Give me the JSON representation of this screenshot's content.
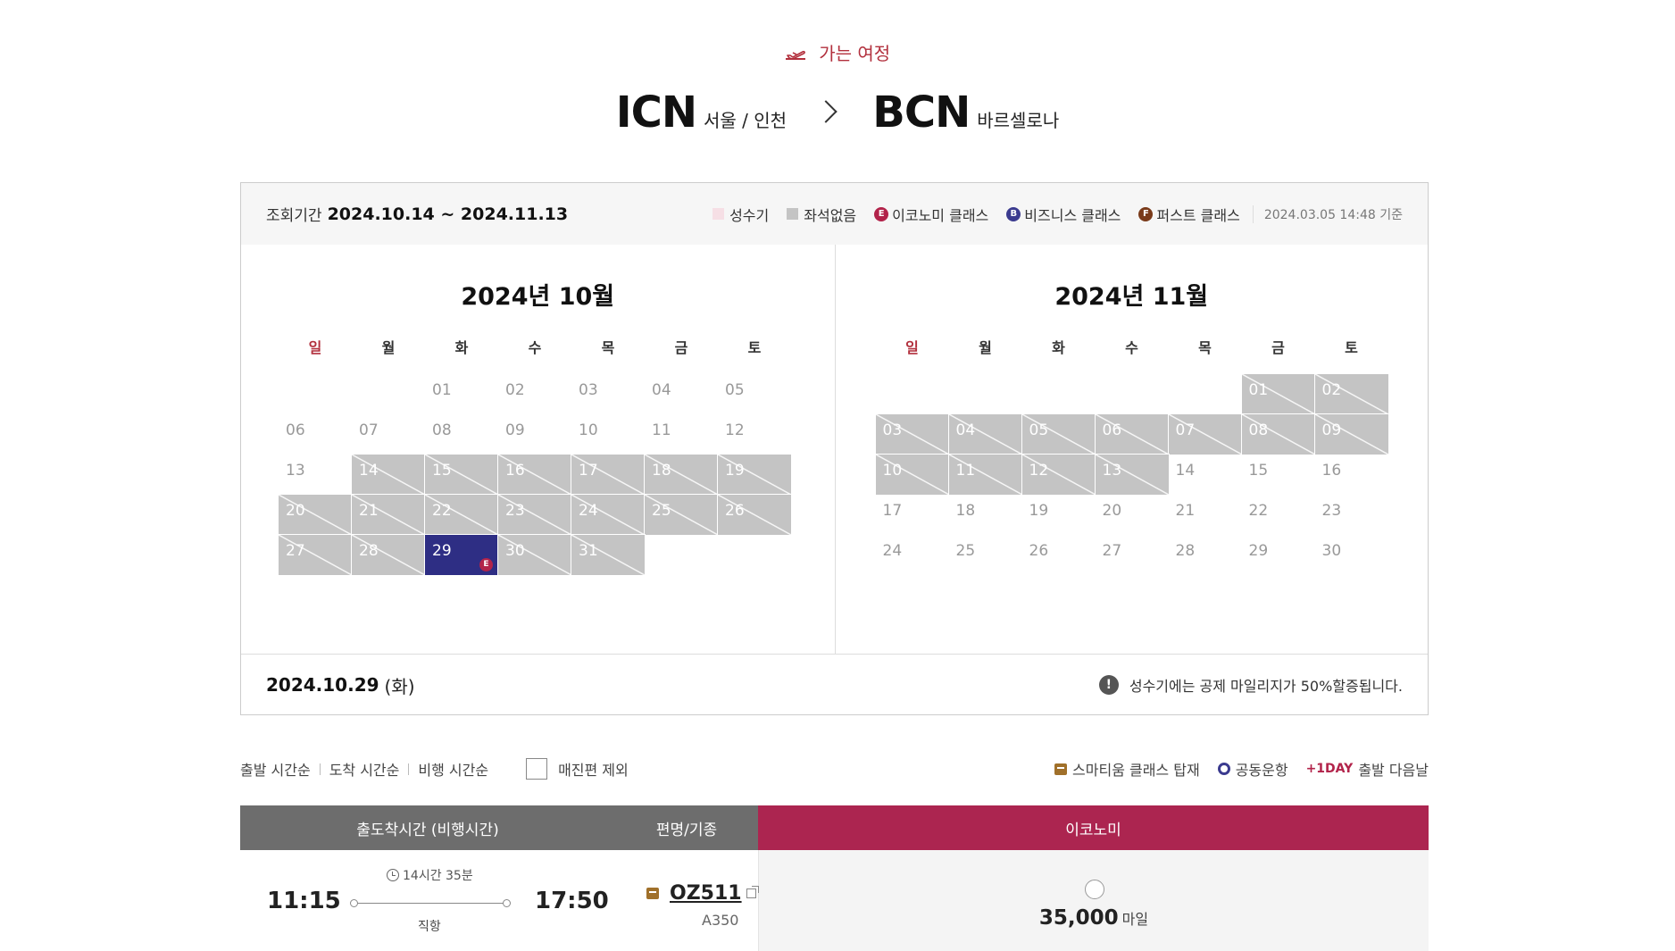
{
  "header": {
    "trip_label": "가는 여정",
    "origin_code": "ICN",
    "origin_city": "서울 / 인천",
    "dest_code": "BCN",
    "dest_city": "바르셀로나"
  },
  "calendar": {
    "period_label": "조회기간",
    "period_value": "2024.10.14 ~ 2024.11.13",
    "legend": {
      "peak": "성수기",
      "no_seats": "좌석없음",
      "economy": "이코노미 클래스",
      "business": "비즈니스 클래스",
      "first": "퍼스트 클래스",
      "economy_badge": "E",
      "business_badge": "B",
      "first_badge": "F",
      "updated": "2024.03.05 14:48 기준"
    },
    "weekdays": [
      "일",
      "월",
      "화",
      "수",
      "목",
      "금",
      "토"
    ],
    "months": [
      {
        "title": "2024년 10월",
        "first_weekday": 2,
        "days": [
          "01",
          "02",
          "03",
          "04",
          "05",
          "06",
          "07",
          "08",
          "09",
          "10",
          "11",
          "12",
          "13",
          "14",
          "15",
          "16",
          "17",
          "18",
          "19",
          "20",
          "21",
          "22",
          "23",
          "24",
          "25",
          "26",
          "27",
          "28",
          "29",
          "30",
          "31"
        ],
        "no_seat_days": [
          14,
          15,
          16,
          17,
          18,
          19,
          20,
          21,
          22,
          23,
          24,
          25,
          26,
          27,
          28,
          30,
          31
        ],
        "selected_day": 29,
        "selected_badge": "E"
      },
      {
        "title": "2024년 11월",
        "first_weekday": 5,
        "days": [
          "01",
          "02",
          "03",
          "04",
          "05",
          "06",
          "07",
          "08",
          "09",
          "10",
          "11",
          "12",
          "13",
          "14",
          "15",
          "16",
          "17",
          "18",
          "19",
          "20",
          "21",
          "22",
          "23",
          "24",
          "25",
          "26",
          "27",
          "28",
          "29",
          "30"
        ],
        "no_seat_days": [
          1,
          2,
          3,
          4,
          5,
          6,
          7,
          8,
          9,
          10,
          11,
          12,
          13
        ],
        "selected_day": null,
        "selected_badge": null
      }
    ],
    "selected_date": "2024.10.29",
    "selected_dow": "(화)",
    "notice": "성수기에는 공제 마일리지가 50%할증됩니다.",
    "notice_icon": "!"
  },
  "sort": {
    "by_departure": "출발 시간순",
    "by_arrival": "도착 시간순",
    "by_duration": "비행 시간순",
    "exclude_soldout": "매진편 제외",
    "legend_smartium": "스마티움 클래스 탑재",
    "legend_codeshare": "공동운항",
    "legend_plus1_tag": "+1DAY",
    "legend_plus1_text": "출발 다음날"
  },
  "table": {
    "col_times": "출도착시간 (비행시간)",
    "col_flight": "편명/기종",
    "col_economy": "이코노미",
    "rows": [
      {
        "departure": "11:15",
        "arrival": "17:50",
        "duration": "14시간 35분",
        "stops": "직항",
        "flight_no": "OZ511",
        "aircraft": "A350",
        "economy_miles": "35,000",
        "miles_unit": "마일"
      }
    ]
  },
  "colors": {
    "accent_red": "#b2303d",
    "economy_header": "#ac2550",
    "selected_day": "#2e2e84",
    "no_seat": "#c4c4c4"
  }
}
